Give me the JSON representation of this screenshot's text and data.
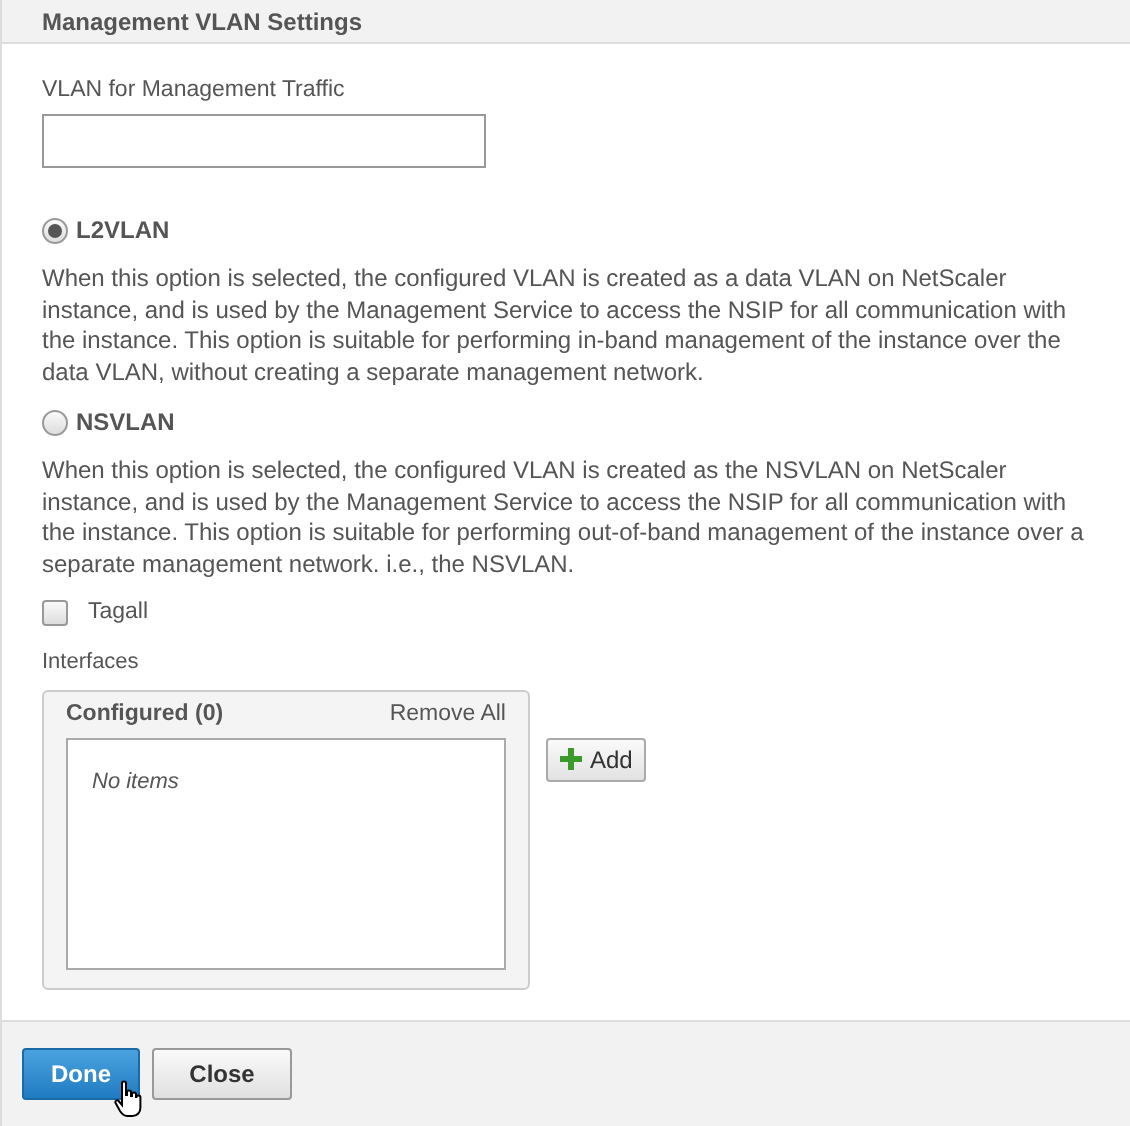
{
  "section": {
    "title": "Management VLAN Settings"
  },
  "vlan_field": {
    "label": "VLAN for Management Traffic"
  },
  "options": [
    {
      "label": "L2VLAN",
      "selected": true,
      "description": "When this option is selected, the configured VLAN is created as a data VLAN on NetScaler instance, and is used by the Management Service to access the NSIP for all communication with the instance. This option is suitable for performing in-band management of the instance over the data VLAN, without creating a separate management network."
    },
    {
      "label": "NSVLAN",
      "selected": false,
      "description": "When this option is selected, the configured VLAN is created as the NSVLAN on NetScaler instance, and is used by the Management Service to access the NSIP for all communication with the instance. This option is suitable for performing out-of-band management of the instance over a separate management network. i.e., the NSVLAN."
    }
  ],
  "tagall": {
    "label": "Tagall",
    "checked": false
  },
  "interfaces": {
    "label": "Interfaces",
    "configured_title": "Configured (0)",
    "remove_all": "Remove All",
    "empty_text": "No items",
    "add_button": "Add"
  },
  "buttons": [
    {
      "label": "Done",
      "kind": "primary"
    },
    {
      "label": "Close",
      "kind": "secondary"
    }
  ]
}
